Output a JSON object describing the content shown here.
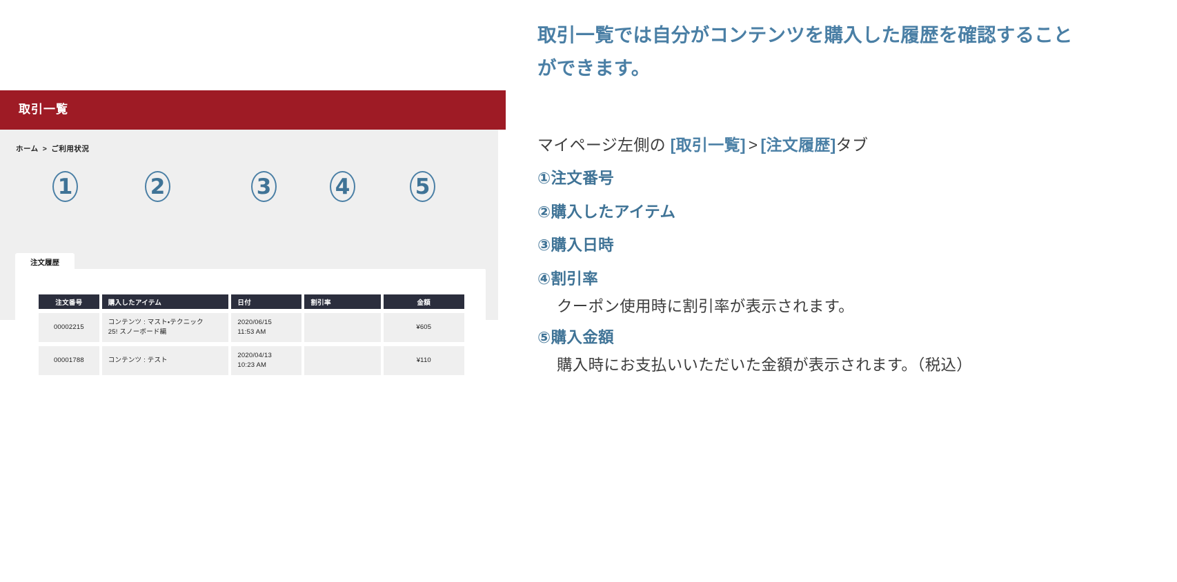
{
  "mock": {
    "header_title": "取引一覧",
    "breadcrumb": {
      "home": "ホーム",
      "separator": ">",
      "current": "ご利用状況"
    },
    "tab_label": "注文履歴",
    "table": {
      "columns": [
        "注文番号",
        "購入したアイテム",
        "日付",
        "割引率",
        "金額"
      ],
      "rows": [
        {
          "order_no": "00002215",
          "item": "コンテンツ : マスト・テクニック\n25! スノーボード編",
          "date": "2020/06/15\n11:53 AM",
          "discount": "",
          "amount": "¥605"
        },
        {
          "order_no": "00001788",
          "item": "コンテンツ : テスト",
          "date": "2020/04/13\n10:23 AM",
          "discount": "",
          "amount": "¥110"
        }
      ]
    },
    "badges": [
      "1",
      "2",
      "3",
      "4",
      "5"
    ],
    "colors": {
      "header_bg": "#9e1b25",
      "table_header_bg": "#2b2e3d",
      "badge_outline": "#4a7fa5",
      "page_bg": "#efefef"
    }
  },
  "explain": {
    "heading": "取引一覧では自分がコンテンツを購入した履歴を確認することができます。",
    "nav": {
      "prefix": "マイページ左側の",
      "link1": "[取引一覧]",
      "gt": ">",
      "link2": "[注文履歴]",
      "suffix": "タブ"
    },
    "items": [
      {
        "label": "①注文番号",
        "sub": ""
      },
      {
        "label": "②購入したアイテム",
        "sub": ""
      },
      {
        "label": "③購入日時",
        "sub": ""
      },
      {
        "label": "④割引率",
        "sub": "クーポン使用時に割引率が表示されます。"
      },
      {
        "label": "⑤購入金額",
        "sub": "購入時にお支払いいただいた金額が表示されます。（税込）"
      }
    ],
    "colors": {
      "accent": "#4a7fa5",
      "body_text": "#3d3d3d"
    }
  }
}
